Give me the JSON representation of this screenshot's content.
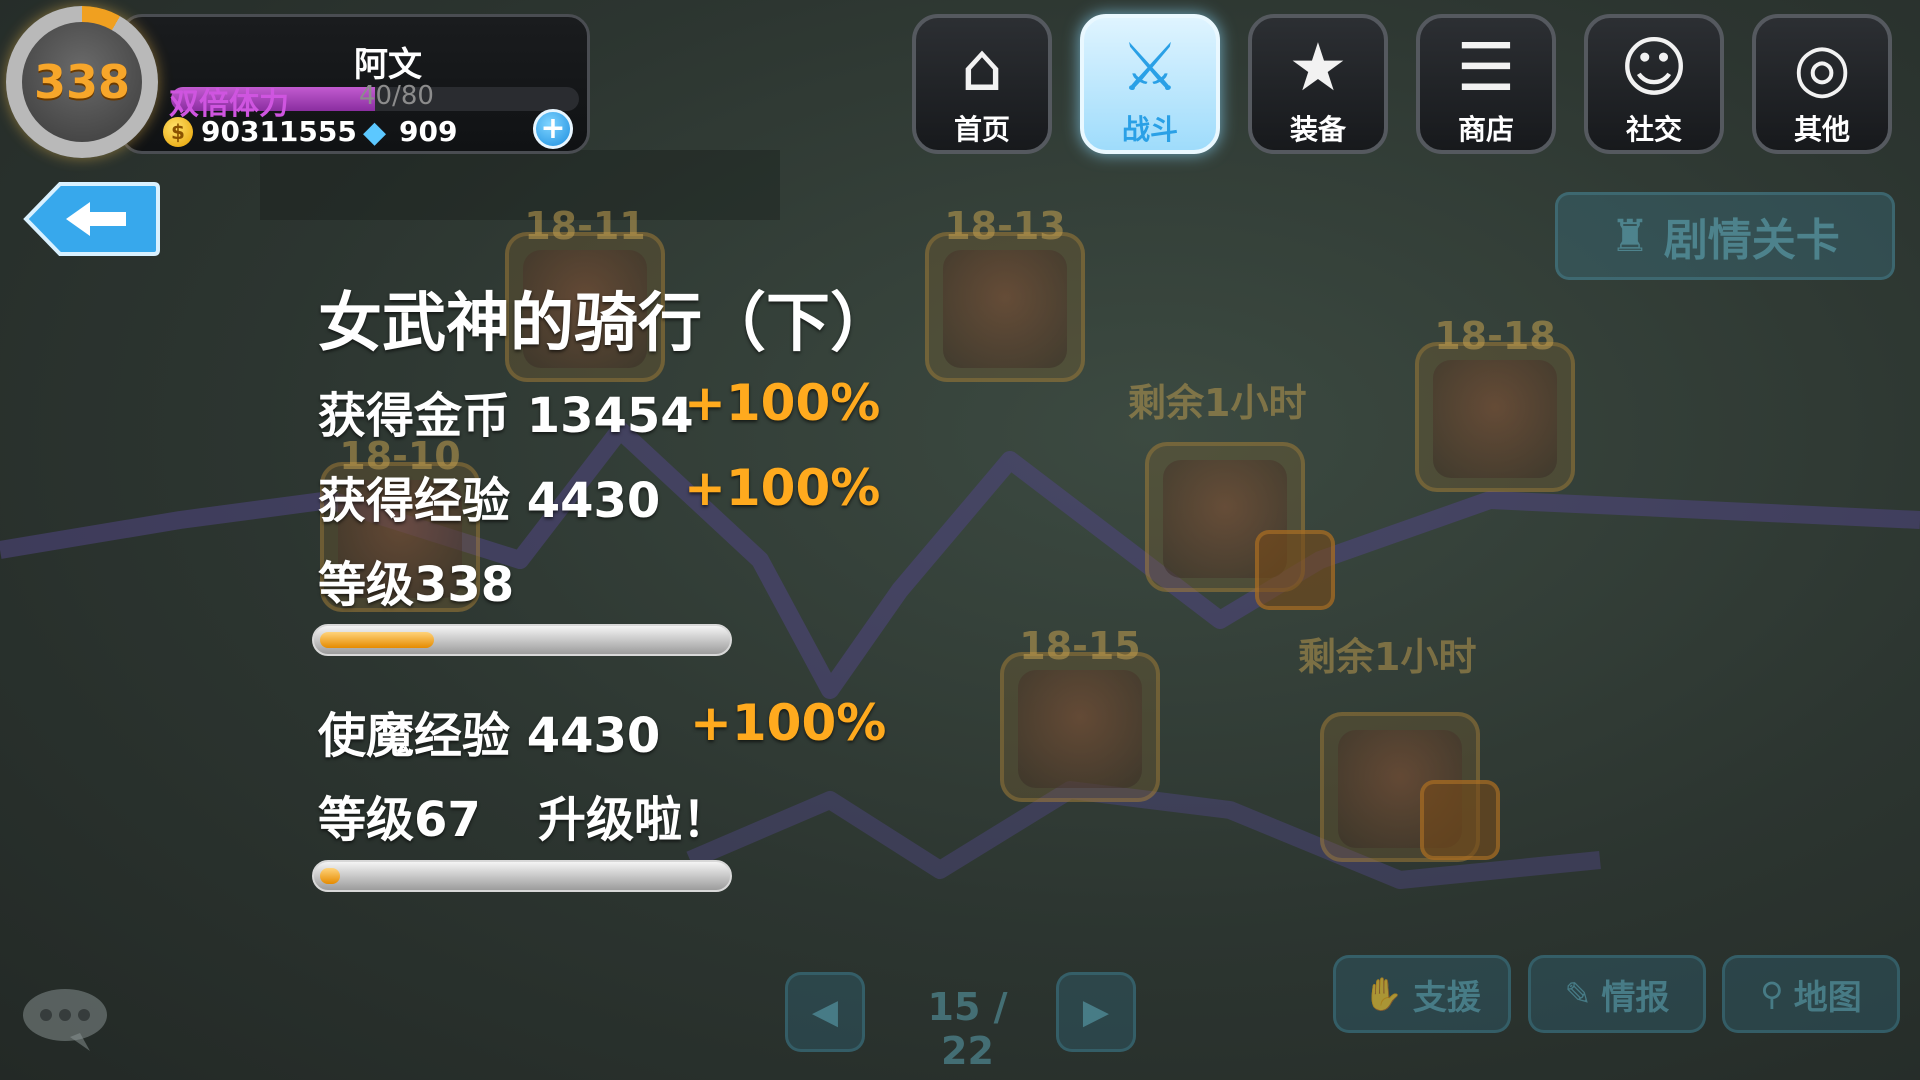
{
  "player": {
    "level": "338",
    "name": "阿文",
    "stamina_label": "双倍体力",
    "stamina_value": "40/80",
    "stamina_current": 40,
    "stamina_max": 80,
    "gold": "90311555",
    "gems": "909"
  },
  "nav": [
    {
      "label": "首页",
      "icon": "home-icon",
      "active": false
    },
    {
      "label": "战斗",
      "icon": "battle-icon",
      "active": true
    },
    {
      "label": "装备",
      "icon": "equipment-icon",
      "active": false
    },
    {
      "label": "商店",
      "icon": "shop-icon",
      "active": false
    },
    {
      "label": "社交",
      "icon": "social-icon",
      "active": false
    },
    {
      "label": "其他",
      "icon": "other-icon",
      "active": false
    }
  ],
  "story_button": "剧情关卡",
  "map": {
    "stage_labels": [
      "18-11",
      "18-13",
      "18-18",
      "18-10",
      "18-15"
    ],
    "remaining_labels": [
      "剩余1小时",
      "剩余1小时"
    ],
    "pager": "15 / 22",
    "buttons": [
      "支援",
      "情报",
      "地图"
    ]
  },
  "result": {
    "title": "女武神的骑行（下）",
    "gold_line": "获得金币 13454",
    "gold_bonus": "+100%",
    "exp_line": "获得经验 4430",
    "exp_bonus": "+100%",
    "level_line": "等级338",
    "level_progress": 0.28,
    "familiar_exp_line": "使魔经验 4430",
    "familiar_exp_bonus": "+100%",
    "familiar_level_line": "等级67",
    "level_up_text": "升级啦！",
    "familiar_progress": 0.05
  },
  "colors": {
    "accent_orange": "#ffaa1e",
    "active_tab": "#2aa0e6",
    "stamina": "#cf55e0"
  }
}
